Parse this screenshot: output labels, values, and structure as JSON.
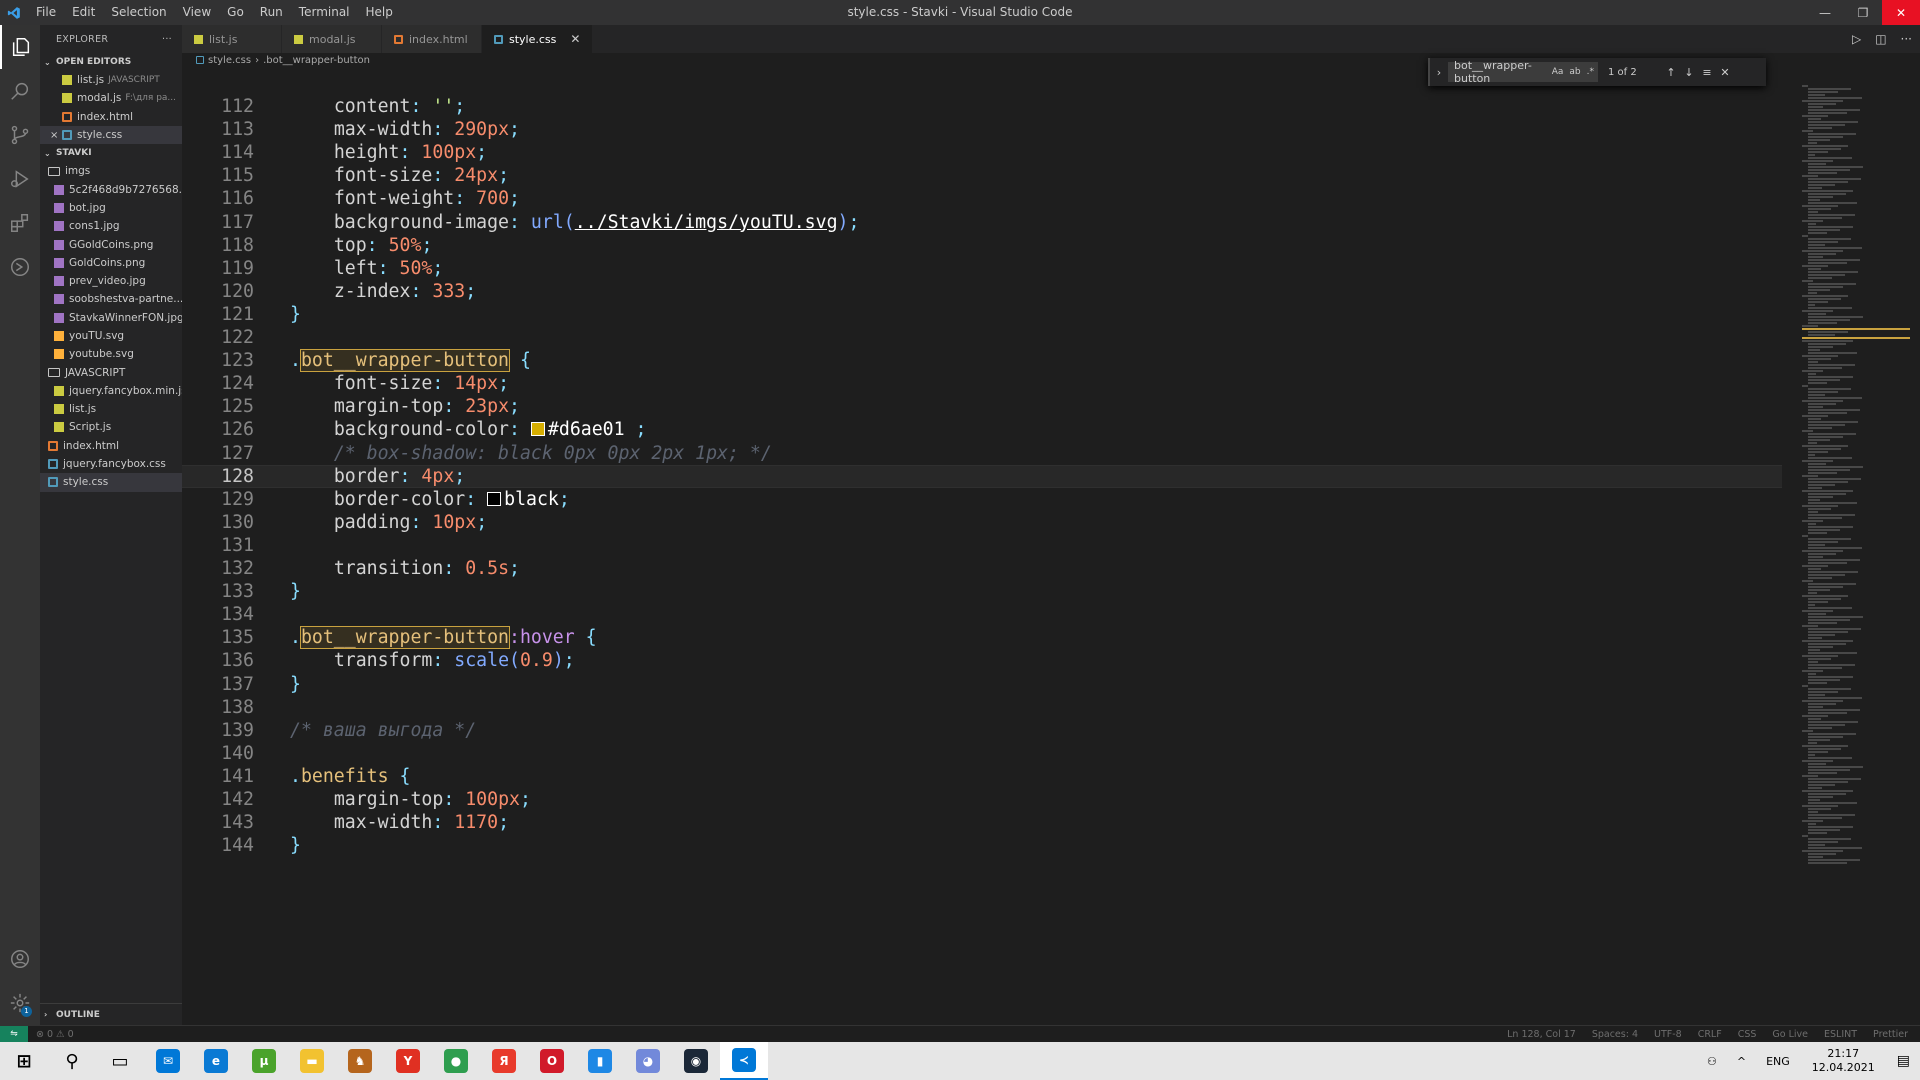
{
  "window": {
    "title": "style.css - Stavki - Visual Studio Code",
    "menu": [
      "File",
      "Edit",
      "Selection",
      "View",
      "Go",
      "Run",
      "Terminal",
      "Help"
    ],
    "minimize": "—",
    "maximize": "❐",
    "close": "✕"
  },
  "sidebar": {
    "header": "EXPLORER",
    "more": "···",
    "open_editors_title": "OPEN EDITORS",
    "open_editors": [
      {
        "name": "list.js",
        "desc": "JAVASCRIPT",
        "type": "js"
      },
      {
        "name": "modal.js",
        "desc": "F:\\для ра...",
        "type": "js"
      },
      {
        "name": "index.html",
        "desc": "",
        "type": "html"
      },
      {
        "name": "style.css",
        "desc": "",
        "type": "css",
        "active": true
      }
    ],
    "project_title": "STAVKI",
    "tree": [
      {
        "name": "imgs",
        "type": "folder",
        "indent": 1
      },
      {
        "name": "5c2f468d9b7276568...",
        "type": "img",
        "indent": 2
      },
      {
        "name": "bot.jpg",
        "type": "img",
        "indent": 2
      },
      {
        "name": "cons1.jpg",
        "type": "img",
        "indent": 2
      },
      {
        "name": "GGoldCoins.png",
        "type": "img",
        "indent": 2
      },
      {
        "name": "GoldCoins.png",
        "type": "img",
        "indent": 2
      },
      {
        "name": "prev_video.jpg",
        "type": "img",
        "indent": 2
      },
      {
        "name": "soobshestva-partne...",
        "type": "img",
        "indent": 2
      },
      {
        "name": "StavkaWinnerFON.jpg",
        "type": "img",
        "indent": 2
      },
      {
        "name": "youTU.svg",
        "type": "svg",
        "indent": 2
      },
      {
        "name": "youtube.svg",
        "type": "svg",
        "indent": 2
      },
      {
        "name": "JAVASCRIPT",
        "type": "folder",
        "indent": 1
      },
      {
        "name": "jquery.fancybox.min.js",
        "type": "js",
        "indent": 2
      },
      {
        "name": "list.js",
        "type": "js",
        "indent": 2
      },
      {
        "name": "Script.js",
        "type": "js",
        "indent": 2
      },
      {
        "name": "index.html",
        "type": "html",
        "indent": 1
      },
      {
        "name": "jquery.fancybox.css",
        "type": "css",
        "indent": 1
      },
      {
        "name": "style.css",
        "type": "css",
        "indent": 1,
        "active": true
      }
    ],
    "outline_title": "OUTLINE"
  },
  "tabs": [
    {
      "label": "list.js",
      "type": "js"
    },
    {
      "label": "modal.js",
      "type": "js"
    },
    {
      "label": "index.html",
      "type": "html"
    },
    {
      "label": "style.css",
      "type": "css",
      "active": true
    }
  ],
  "breadcrumb": [
    "style.css",
    ".bot__wrapper-button"
  ],
  "find": {
    "query": "bot__wrapper-button",
    "opt_case": "Aa",
    "opt_word": "ab",
    "opt_regex": ".*",
    "count": "1 of 2"
  },
  "editor": {
    "current_line": 128,
    "lines": [
      {
        "n": "112",
        "tokens": [
          [
            "t-plain",
            "    "
          ],
          [
            "t-prop",
            "content"
          ],
          [
            "t-punc",
            ": "
          ],
          [
            "t-str",
            "''"
          ],
          [
            "t-punc",
            ";"
          ]
        ]
      },
      {
        "n": "113",
        "tokens": [
          [
            "t-plain",
            "    "
          ],
          [
            "t-prop",
            "max-width"
          ],
          [
            "t-punc",
            ": "
          ],
          [
            "t-num",
            "290px"
          ],
          [
            "t-punc",
            ";"
          ]
        ]
      },
      {
        "n": "114",
        "tokens": [
          [
            "t-plain",
            "    "
          ],
          [
            "t-prop",
            "height"
          ],
          [
            "t-punc",
            ": "
          ],
          [
            "t-num",
            "100px"
          ],
          [
            "t-punc",
            ";"
          ]
        ]
      },
      {
        "n": "115",
        "tokens": [
          [
            "t-plain",
            "    "
          ],
          [
            "t-prop",
            "font-size"
          ],
          [
            "t-punc",
            ": "
          ],
          [
            "t-num",
            "24px"
          ],
          [
            "t-punc",
            ";"
          ]
        ]
      },
      {
        "n": "116",
        "tokens": [
          [
            "t-plain",
            "    "
          ],
          [
            "t-prop",
            "font-weight"
          ],
          [
            "t-punc",
            ": "
          ],
          [
            "t-num",
            "700"
          ],
          [
            "t-punc",
            ";"
          ]
        ]
      },
      {
        "n": "117",
        "tokens": [
          [
            "t-plain",
            "    "
          ],
          [
            "t-prop",
            "background-image"
          ],
          [
            "t-punc",
            ": "
          ],
          [
            "t-fn",
            "url("
          ],
          [
            "t-url",
            "../Stavki/imgs/youTU.svg"
          ],
          [
            "t-fn",
            ")"
          ],
          [
            "t-punc",
            ";"
          ]
        ]
      },
      {
        "n": "118",
        "tokens": [
          [
            "t-plain",
            "    "
          ],
          [
            "t-prop",
            "top"
          ],
          [
            "t-punc",
            ": "
          ],
          [
            "t-num",
            "50%"
          ],
          [
            "t-punc",
            ";"
          ]
        ]
      },
      {
        "n": "119",
        "tokens": [
          [
            "t-plain",
            "    "
          ],
          [
            "t-prop",
            "left"
          ],
          [
            "t-punc",
            ": "
          ],
          [
            "t-num",
            "50%"
          ],
          [
            "t-punc",
            ";"
          ]
        ]
      },
      {
        "n": "120",
        "tokens": [
          [
            "t-plain",
            "    "
          ],
          [
            "t-prop",
            "z-index"
          ],
          [
            "t-punc",
            ": "
          ],
          [
            "t-num",
            "333"
          ],
          [
            "t-punc",
            ";"
          ]
        ]
      },
      {
        "n": "121",
        "tokens": [
          [
            "t-punc",
            "}"
          ]
        ]
      },
      {
        "n": "122",
        "tokens": []
      },
      {
        "n": "123",
        "tokens": [
          [
            "t-punc",
            "."
          ],
          [
            "t-sel match",
            "bot__wrapper-button"
          ],
          [
            "t-punc",
            " {"
          ]
        ]
      },
      {
        "n": "124",
        "tokens": [
          [
            "t-plain",
            "    "
          ],
          [
            "t-prop",
            "font-size"
          ],
          [
            "t-punc",
            ": "
          ],
          [
            "t-num",
            "14px"
          ],
          [
            "t-punc",
            ";"
          ]
        ]
      },
      {
        "n": "125",
        "tokens": [
          [
            "t-plain",
            "    "
          ],
          [
            "t-prop",
            "margin-top"
          ],
          [
            "t-punc",
            ": "
          ],
          [
            "t-num",
            "23px"
          ],
          [
            "t-punc",
            ";"
          ]
        ]
      },
      {
        "n": "126",
        "tokens": [
          [
            "t-plain",
            "    "
          ],
          [
            "t-prop",
            "background-color"
          ],
          [
            "t-punc",
            ": "
          ],
          [
            "swatch",
            "#d6ae01"
          ],
          [
            "t-plain",
            "#d6ae01"
          ],
          [
            "t-punc",
            " ;"
          ]
        ]
      },
      {
        "n": "127",
        "tokens": [
          [
            "t-plain",
            "    "
          ],
          [
            "t-comment",
            "/* box-shadow: black 0px 0px 2px 1px; */"
          ]
        ]
      },
      {
        "n": "128",
        "tokens": [
          [
            "t-plain",
            "    "
          ],
          [
            "t-prop",
            "border"
          ],
          [
            "t-punc",
            ": "
          ],
          [
            "t-num",
            "4px"
          ],
          [
            "t-punc",
            ";"
          ]
        ]
      },
      {
        "n": "129",
        "tokens": [
          [
            "t-plain",
            "    "
          ],
          [
            "t-prop",
            "border-color"
          ],
          [
            "t-punc",
            ": "
          ],
          [
            "swatch",
            "#000000"
          ],
          [
            "t-plain",
            "black"
          ],
          [
            "t-punc",
            ";"
          ]
        ]
      },
      {
        "n": "130",
        "tokens": [
          [
            "t-plain",
            "    "
          ],
          [
            "t-prop",
            "padding"
          ],
          [
            "t-punc",
            ": "
          ],
          [
            "t-num",
            "10px"
          ],
          [
            "t-punc",
            ";"
          ]
        ]
      },
      {
        "n": "131",
        "tokens": []
      },
      {
        "n": "132",
        "tokens": [
          [
            "t-plain",
            "    "
          ],
          [
            "t-prop",
            "transition"
          ],
          [
            "t-punc",
            ": "
          ],
          [
            "t-num",
            "0.5s"
          ],
          [
            "t-punc",
            ";"
          ]
        ]
      },
      {
        "n": "133",
        "tokens": [
          [
            "t-punc",
            "}"
          ]
        ]
      },
      {
        "n": "134",
        "tokens": []
      },
      {
        "n": "135",
        "tokens": [
          [
            "t-punc",
            "."
          ],
          [
            "t-sel match",
            "bot__wrapper-button"
          ],
          [
            "t-kw",
            ":hover"
          ],
          [
            "t-punc",
            " {"
          ]
        ]
      },
      {
        "n": "136",
        "tokens": [
          [
            "t-plain",
            "    "
          ],
          [
            "t-prop",
            "transform"
          ],
          [
            "t-punc",
            ": "
          ],
          [
            "t-fn",
            "scale("
          ],
          [
            "t-num",
            "0.9"
          ],
          [
            "t-fn",
            ")"
          ],
          [
            "t-punc",
            ";"
          ]
        ]
      },
      {
        "n": "137",
        "tokens": [
          [
            "t-punc",
            "}"
          ]
        ]
      },
      {
        "n": "138",
        "tokens": []
      },
      {
        "n": "139",
        "tokens": [
          [
            "t-comment",
            "/* ваша выгода */"
          ]
        ]
      },
      {
        "n": "140",
        "tokens": []
      },
      {
        "n": "141",
        "tokens": [
          [
            "t-punc",
            "."
          ],
          [
            "t-sel",
            "benefits"
          ],
          [
            "t-punc",
            " {"
          ]
        ]
      },
      {
        "n": "142",
        "tokens": [
          [
            "t-plain",
            "    "
          ],
          [
            "t-prop",
            "margin-top"
          ],
          [
            "t-punc",
            ": "
          ],
          [
            "t-num",
            "100px"
          ],
          [
            "t-punc",
            ";"
          ]
        ]
      },
      {
        "n": "143",
        "tokens": [
          [
            "t-plain",
            "    "
          ],
          [
            "t-prop",
            "max-width"
          ],
          [
            "t-punc",
            ": "
          ],
          [
            "t-num",
            "1170"
          ],
          [
            "t-punc",
            ";"
          ]
        ]
      },
      {
        "n": "144",
        "tokens": [
          [
            "t-punc",
            "}"
          ]
        ]
      }
    ]
  },
  "statusbar": {
    "problems": "⊗ 0 ⚠ 0",
    "items": [
      "Ln 128, Col 17",
      "Spaces: 4",
      "UTF-8",
      "CRLF",
      "CSS",
      "Go Live",
      "ESLINT",
      "Prettier"
    ]
  },
  "taskbar": {
    "apps": [
      {
        "name": "start",
        "glyph": "⊞",
        "color": "#000000"
      },
      {
        "name": "search",
        "glyph": "⚲",
        "color": "#000000"
      },
      {
        "name": "task-view",
        "glyph": "▭",
        "color": "#000000"
      },
      {
        "name": "mail",
        "glyph": "✉",
        "color": "#0078d7"
      },
      {
        "name": "edge",
        "glyph": "e",
        "color": "#0a7ad4"
      },
      {
        "name": "torrent",
        "glyph": "μ",
        "color": "#4aa32b"
      },
      {
        "name": "file-explorer",
        "glyph": "▬",
        "color": "#f2c230"
      },
      {
        "name": "game",
        "glyph": "♞",
        "color": "#b5651d"
      },
      {
        "name": "yandex-browser",
        "glyph": "Y",
        "color": "#e03022"
      },
      {
        "name": "chrome",
        "glyph": "●",
        "color": "#2e9e4f"
      },
      {
        "name": "yandex",
        "glyph": "Я",
        "color": "#e83a2b"
      },
      {
        "name": "opera",
        "glyph": "O",
        "color": "#d11a2a"
      },
      {
        "name": "files",
        "glyph": "▮",
        "color": "#1e88e5"
      },
      {
        "name": "discord",
        "glyph": "◕",
        "color": "#7289da"
      },
      {
        "name": "steam",
        "glyph": "◉",
        "color": "#1b2838"
      },
      {
        "name": "vscode",
        "glyph": "≺",
        "color": "#0078d7",
        "active": true
      }
    ],
    "tray": {
      "people": "⚇",
      "arrow": "^",
      "lang": "ENG",
      "time": "21:17",
      "date": "12.04.2021",
      "notifications": "▤"
    }
  }
}
